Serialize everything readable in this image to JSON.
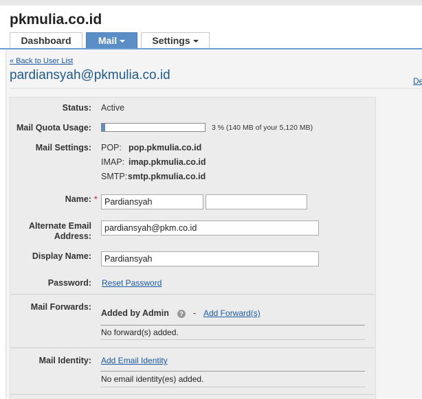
{
  "site": {
    "title": "pkmulia.co.id"
  },
  "tabs": [
    {
      "label": "Dashboard",
      "active": false
    },
    {
      "label": "Mail",
      "active": true
    },
    {
      "label": "Settings",
      "active": false
    }
  ],
  "nav": {
    "back_link": "« Back to User List",
    "right_cut_link": "De"
  },
  "page": {
    "title": "pardiansyah@pkmulia.co.id"
  },
  "fields": {
    "status": {
      "label": "Status:",
      "value": "Active"
    },
    "quota": {
      "label": "Mail Quota Usage:",
      "percent": 3,
      "text": "3 % (140 MB of your 5,120 MB)"
    },
    "mail_settings": {
      "label": "Mail Settings:",
      "pop_label": "POP:",
      "pop_value": "pop.pkmulia.co.id",
      "imap_label": "IMAP:",
      "imap_value": "imap.pkmulia.co.id",
      "smtp_label": "SMTP:",
      "smtp_value": "smtp.pkmulia.co.id"
    },
    "name": {
      "label": "Name:",
      "required_mark": "*",
      "first": "Pardiansyah",
      "last": ""
    },
    "alt_email": {
      "label_line1": "Alternate Email",
      "label_line2": "Address:",
      "value": "pardiansyah@pkm.co.id"
    },
    "display_name": {
      "label": "Display Name:",
      "value": "Pardiansyah"
    },
    "password": {
      "label": "Password:",
      "link": "Reset Password"
    }
  },
  "forwards": {
    "label": "Mail Forwards:",
    "added_by": "Added by Admin",
    "dash": "-",
    "add_link": "Add Forward(s)",
    "empty_text": "No forward(s) added."
  },
  "identity": {
    "label": "Mail Identity:",
    "add_link": "Add Email Identity",
    "empty_text": "No email identity(es) added."
  },
  "colors": {
    "accent": "#5b8ec7",
    "link": "#1a5aa3",
    "title": "#1e5a8e"
  }
}
